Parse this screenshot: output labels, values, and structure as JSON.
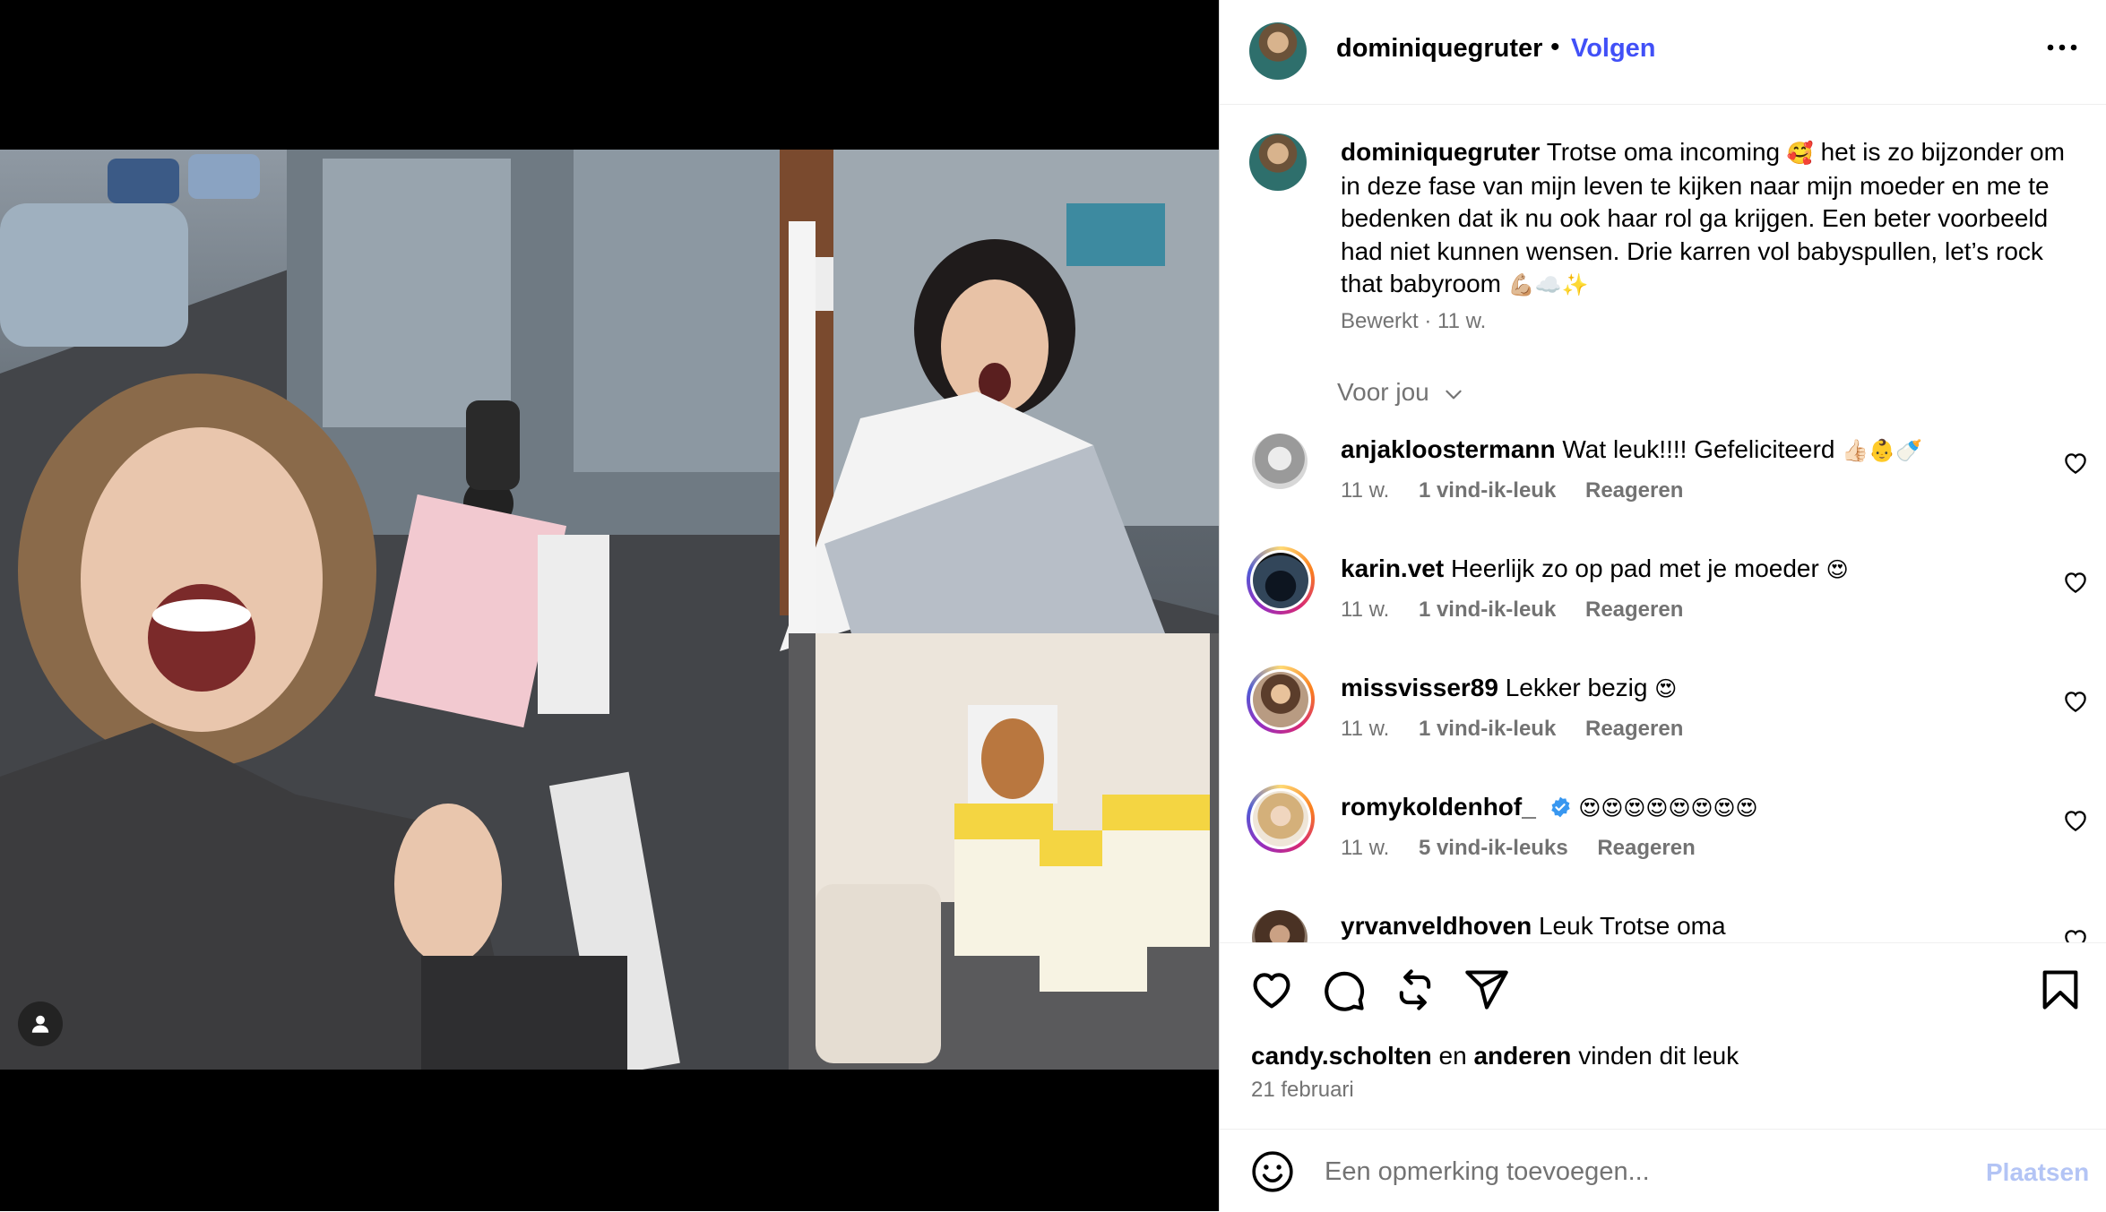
{
  "post": {
    "username": "dominiquegruter",
    "follow_label": "Volgen",
    "dot": "•",
    "more_icon": "more-horizontal-icon"
  },
  "caption": {
    "username": "dominiquegruter",
    "text_part1": "Trotse oma incoming",
    "emoji1": "🥰",
    "text_part2": "het is zo bijzonder om in deze fase van mijn leven te kijken naar mijn moeder en me te bedenken dat ik nu ook haar rol ga krijgen. Een beter voorbeeld had niet kunnen wensen. Drie karren vol babyspullen, let’s rock that babyroom",
    "emoji2": "💪🏼☁️✨",
    "edited": "Bewerkt",
    "time": "11 w."
  },
  "for_you": "Voor jou",
  "comments": [
    {
      "username": "anjakloostermann",
      "text": "Wat leuk!!!! Gefeliciteerd",
      "emoji": "👍🏻👶🍼",
      "time": "11 w.",
      "likes": "1 vind-ik-leuk",
      "reply": "Reageren",
      "avatar_style": "gray",
      "story_ring": false
    },
    {
      "username": "karin.vet",
      "text": "Heerlijk zo op pad met je moeder",
      "emoji": "😍",
      "time": "11 w.",
      "likes": "1 vind-ik-leuk",
      "reply": "Reageren",
      "avatar_style": "dark",
      "story_ring": true
    },
    {
      "username": "missvisser89",
      "text": "Lekker bezig",
      "emoji": "😍",
      "time": "11 w.",
      "likes": "1 vind-ik-leuk",
      "reply": "Reageren",
      "avatar_style": "warm",
      "story_ring": true
    },
    {
      "username": "romykoldenhof_",
      "text": "",
      "emoji": "😍😍😍😍😍😍😍😍",
      "time": "11 w.",
      "likes": "5 vind-ik-leuks",
      "reply": "Reageren",
      "avatar_style": "blonde",
      "story_ring": true,
      "verified": true
    },
    {
      "username": "yrvanveldhoven",
      "text": "Leuk Trotse oma",
      "emoji": "",
      "time": "",
      "likes": "",
      "reply": "",
      "avatar_style": "brown",
      "story_ring": false
    }
  ],
  "liked_by": {
    "user": "candy.scholten",
    "and": "en",
    "others": "anderen",
    "suffix": "vinden dit leuk"
  },
  "date": "21 februari",
  "add_comment": {
    "placeholder": "Een opmerking toevoegen...",
    "post_label": "Plaatsen",
    "emoji_icon": "smiley-icon"
  },
  "colors": {
    "follow": "#4150f7",
    "muted": "#737373",
    "post_disabled": "#b3c4f5"
  }
}
